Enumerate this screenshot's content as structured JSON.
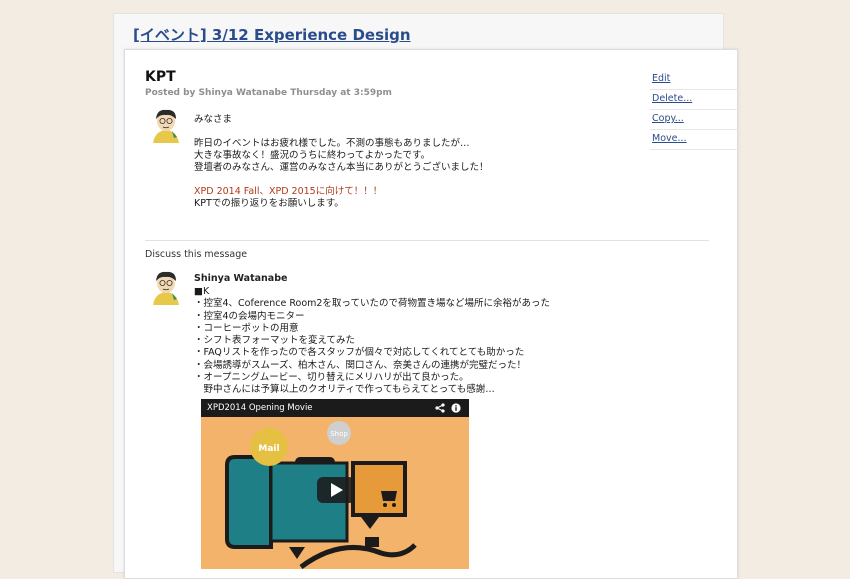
{
  "group_title": "[イベント] 3/12 Experience Design",
  "post": {
    "title": "KPT",
    "meta": "Posted by Shinya Watanabe Thursday at 3:59pm",
    "body": [
      "みなさま",
      "",
      "昨日のイベントはお疲れ様でした。不測の事態もありましたが…",
      "大きな事故なく！盛況のうちに終わってよかったです。",
      "登壇者のみなさん、運営のみなさん本当にありがとうございました！",
      "",
      "XPD 2014 Fall、XPD 2015に向けて！！！",
      "KPTでの振り返りをお願いします。"
    ]
  },
  "actions": [
    "Edit",
    "Delete...",
    "Copy...",
    "Move..."
  ],
  "discuss_label": "Discuss this message",
  "reply": {
    "author": "Shinya Watanabe",
    "lines": [
      "■K",
      "・控室4、Coference Room2を取っていたので荷物置き場など場所に余裕があった",
      "・控室4の会場内モニター",
      "・コーヒーポットの用意",
      "・シフト表フォーマットを変えてみた",
      "・FAQリストを作ったので各スタッフが個々で対応してくれてとても助かった",
      "・会場誘導がスムーズ、柏木さん、関口さん、奈美さんの連携が完璧だった！",
      "・オープニングムービー、切り替えにメリハリが出て良かった。",
      "　野中さんには予算以上のクオリティで作ってもらえてとっても感謝…"
    ]
  },
  "video": {
    "title": "XPD2014 Opening Movie",
    "label_mail": "Mail",
    "label_shop": "Shop",
    "share_icon": "share-icon",
    "info_icon": "info-icon",
    "play_icon": "play-icon"
  },
  "colors": {
    "link": "#2a4c8c",
    "background": "#f3ece3",
    "video_bg": "#f3b36a",
    "teal": "#1f7f86"
  }
}
